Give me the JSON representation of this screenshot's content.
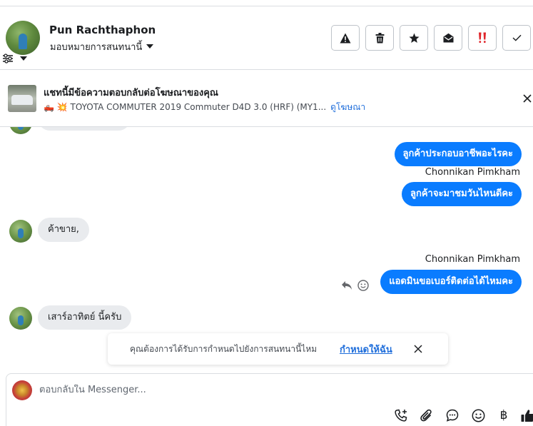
{
  "header": {
    "contact_name": "Pun Rachthaphon",
    "assign_label": "มอบหมายการสนทนานี้",
    "actions": [
      {
        "name": "report-button",
        "icon": "warning-icon"
      },
      {
        "name": "delete-button",
        "icon": "trash-icon"
      },
      {
        "name": "star-button",
        "icon": "star-icon"
      },
      {
        "name": "mark-unread-button",
        "icon": "envelope-open-icon"
      },
      {
        "name": "follow-up-button",
        "icon": "double-exclamation-icon"
      },
      {
        "name": "mark-done-button",
        "icon": "check-icon"
      }
    ]
  },
  "ad_banner": {
    "title": "แชทนี้มีข้อความตอบกลับต่อโฆษณาของคุณ",
    "subtitle": "🛻 💥 TOYOTA COMMUTER 2019 Commuter D4D 3.0 (HRF) (MY1...",
    "link": "ดูโฆษณา"
  },
  "messages": {
    "outgoing_1": "ลูกค้าประกอบอาชีพอะไรคะ",
    "sender_1": "Chonnikan Pimkham",
    "outgoing_2": "ลูกค้าจะมาชมวันไหนดีคะ",
    "incoming_1": "ค้าขาย,",
    "sender_2": "Chonnikan Pimkham",
    "outgoing_3": "แอดมินขอเบอร์ติดต่อได้ไหมคะ",
    "incoming_2": "เสาร์อาทิตย์ นี้ครับ"
  },
  "assign_prompt": {
    "question": "คุณต้องการได้รับการกำหนดไปยังการสนทนานี้ไหม",
    "action": "กำหนดให้ฉัน"
  },
  "composer": {
    "placeholder": "ตอบกลับใน Messenger...",
    "currency_symbol": "฿"
  },
  "colors": {
    "outgoing_bubble": "#0a7cff",
    "incoming_bubble": "#e9ebee",
    "link": "#216fdb",
    "follow_up_red": "#e0252a"
  }
}
